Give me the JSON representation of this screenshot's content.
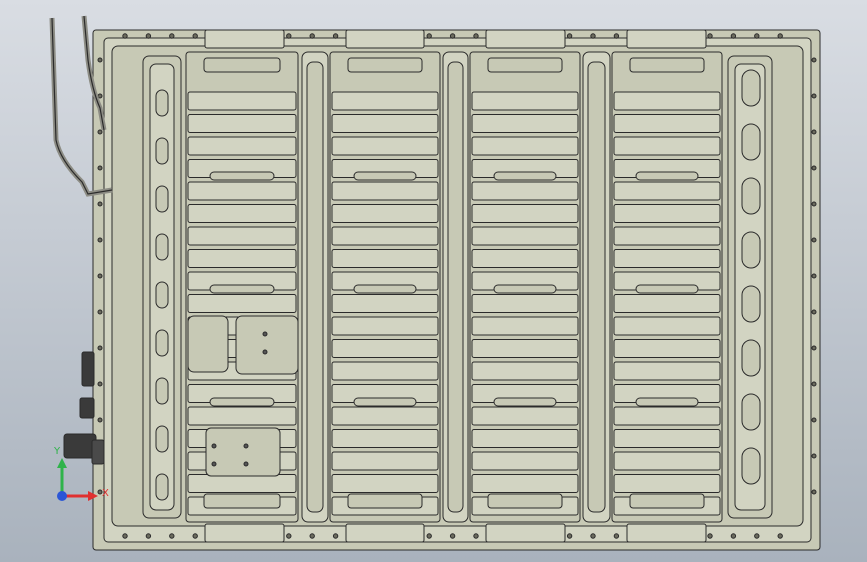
{
  "viewport": {
    "background_top": "#d9dde3",
    "background_bottom": "#a9b2bd",
    "model_fill": "#c7c9b5",
    "model_fill_light": "#d2d4c2",
    "model_edge": "#2b2b2b"
  },
  "triad": {
    "x_label": "X",
    "y_label": "Y",
    "x_color": "#e03030",
    "y_color": "#2fb34a",
    "z_color": "#2b56d6"
  }
}
